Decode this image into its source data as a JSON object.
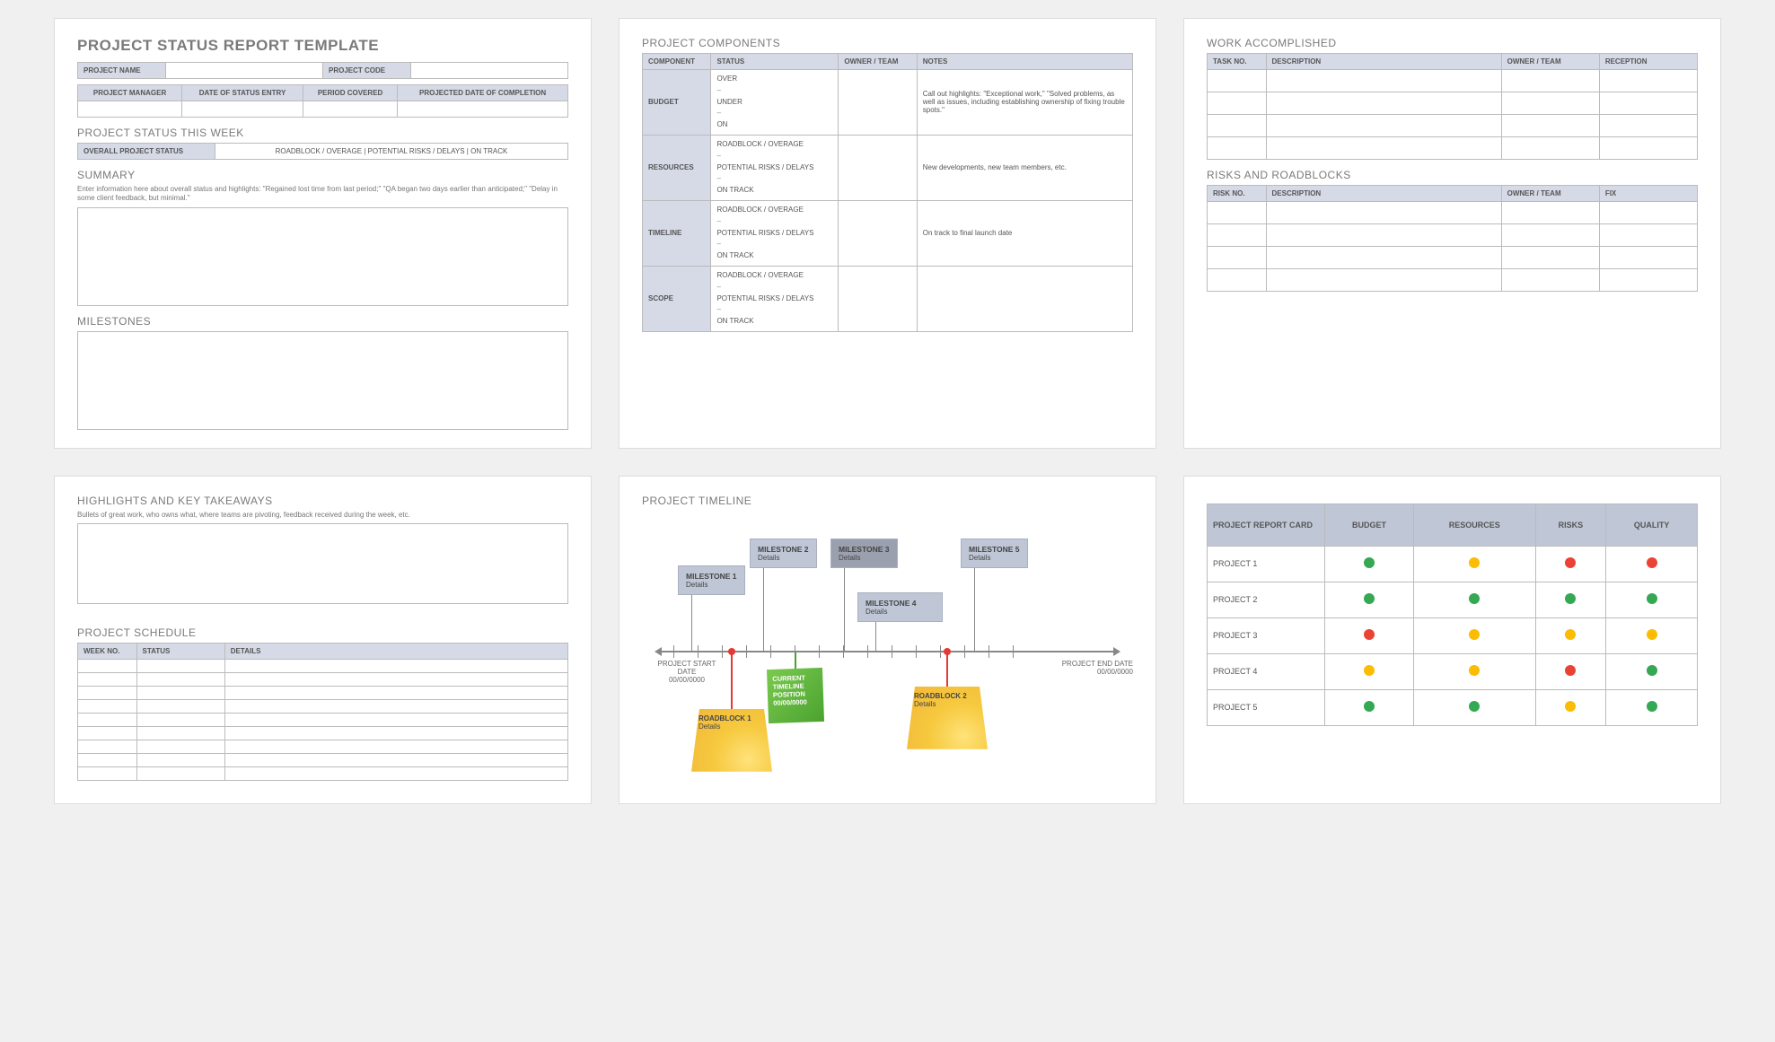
{
  "page1": {
    "title": "PROJECT STATUS REPORT TEMPLATE",
    "proj_name_label": "PROJECT NAME",
    "proj_code_label": "PROJECT CODE",
    "row2": [
      "PROJECT MANAGER",
      "DATE OF STATUS ENTRY",
      "PERIOD COVERED",
      "PROJECTED DATE OF COMPLETION"
    ],
    "status_week": "PROJECT STATUS THIS WEEK",
    "overall_label": "OVERALL PROJECT STATUS",
    "status_opts": "ROADBLOCK / OVERAGE   |   POTENTIAL RISKS / DELAYS   |   ON TRACK",
    "summary": "SUMMARY",
    "summary_note": "Enter information here about overall status and highlights: \"Regained lost time from last period;\" \"QA began two days earlier than anticipated;\" \"Delay in some client feedback, but minimal.\"",
    "milestones": "MILESTONES"
  },
  "page2": {
    "title": "PROJECT COMPONENTS",
    "headers": [
      "COMPONENT",
      "STATUS",
      "OWNER / TEAM",
      "NOTES"
    ],
    "rows": [
      {
        "comp": "BUDGET",
        "status": [
          "OVER",
          "–",
          "UNDER",
          "–",
          "ON"
        ],
        "note": "Call out highlights: \"Exceptional work,\" \"Solved problems, as well as issues, including establishing ownership of fixing trouble spots.\""
      },
      {
        "comp": "RESOURCES",
        "status": [
          "ROADBLOCK / OVERAGE",
          "–",
          "POTENTIAL RISKS / DELAYS",
          "–",
          "ON TRACK"
        ],
        "note": "New developments, new team members, etc."
      },
      {
        "comp": "TIMELINE",
        "status": [
          "ROADBLOCK / OVERAGE",
          "–",
          "POTENTIAL RISKS / DELAYS",
          "–",
          "ON TRACK"
        ],
        "note": "On track to final launch date"
      },
      {
        "comp": "SCOPE",
        "status": [
          "ROADBLOCK / OVERAGE",
          "–",
          "POTENTIAL RISKS / DELAYS",
          "–",
          "ON TRACK"
        ],
        "note": ""
      }
    ]
  },
  "page3": {
    "work_title": "WORK ACCOMPLISHED",
    "work_headers": [
      "TASK NO.",
      "DESCRIPTION",
      "OWNER / TEAM",
      "RECEPTION"
    ],
    "risk_title": "RISKS AND ROADBLOCKS",
    "risk_headers": [
      "RISK NO.",
      "DESCRIPTION",
      "OWNER / TEAM",
      "FIX"
    ]
  },
  "page4": {
    "highlights_title": "HIGHLIGHTS AND KEY TAKEAWAYS",
    "highlights_note": "Bullets of great work, who owns what, where teams are pivoting, feedback received during the week, etc.",
    "sched_title": "PROJECT SCHEDULE",
    "sched_headers": [
      "WEEK NO.",
      "STATUS",
      "DETAILS"
    ]
  },
  "page5": {
    "title": "PROJECT TIMELINE",
    "milestones": [
      {
        "t": "MILESTONE 1",
        "d": "Details"
      },
      {
        "t": "MILESTONE 2",
        "d": "Details"
      },
      {
        "t": "MILESTONE 3",
        "d": "Details"
      },
      {
        "t": "MILESTONE 4",
        "d": "Details"
      },
      {
        "t": "MILESTONE 5",
        "d": "Details"
      }
    ],
    "roadblocks": [
      {
        "t": "ROADBLOCK 1",
        "d": "Details"
      },
      {
        "t": "ROADBLOCK 2",
        "d": "Details"
      }
    ],
    "current": {
      "l1": "CURRENT",
      "l2": "TIMELINE",
      "l3": "POSITION",
      "date": "00/00/0000"
    },
    "start": {
      "l": "PROJECT START DATE",
      "d": "00/00/0000"
    },
    "end": {
      "l": "PROJECT END DATE",
      "d": "00/00/0000"
    }
  },
  "page6": {
    "headers": [
      "PROJECT REPORT CARD",
      "BUDGET",
      "RESOURCES",
      "RISKS",
      "QUALITY"
    ],
    "rows": [
      {
        "name": "PROJECT 1",
        "cells": [
          "g",
          "y",
          "r",
          "r"
        ]
      },
      {
        "name": "PROJECT 2",
        "cells": [
          "g",
          "g",
          "g",
          "g"
        ]
      },
      {
        "name": "PROJECT 3",
        "cells": [
          "r",
          "y",
          "y",
          "y"
        ]
      },
      {
        "name": "PROJECT 4",
        "cells": [
          "y",
          "y",
          "r",
          "g"
        ]
      },
      {
        "name": "PROJECT 5",
        "cells": [
          "g",
          "g",
          "y",
          "g"
        ]
      }
    ]
  }
}
